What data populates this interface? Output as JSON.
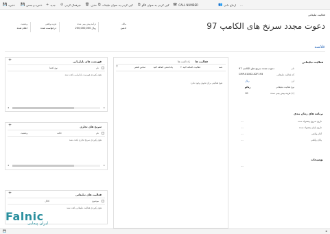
{
  "commands": [
    {
      "label": "ذخیره",
      "icon": "💾",
      "name": "save-button"
    },
    {
      "label": "ذخیره و بستن",
      "icon": "💾",
      "name": "save-close-button"
    },
    {
      "label": "جدید",
      "icon": "+",
      "name": "new-button"
    },
    {
      "label": "غیرفعال کردن",
      "icon": "⊘",
      "name": "deactivate-button"
    },
    {
      "label": "حذف",
      "icon": "🗑",
      "name": "delete-button"
    },
    {
      "label": "کپی کردن به عنوان تبلیغات",
      "icon": "⧉",
      "name": "copy-as-campaign-button"
    },
    {
      "label": "کپی کردن به عنوان الگو",
      "icon": "⧉",
      "name": "copy-as-template-button"
    },
    {
      "label": "CALL NUMBER",
      "icon": "☎",
      "name": "call-number-button"
    },
    {
      "label": "ارجاع دادن",
      "icon": "👥",
      "name": "assign-button"
    },
    {
      "label": "...",
      "icon": "",
      "name": "more-commands-button"
    }
  ],
  "header": {
    "entity": "فعالیت تبلیغاتی",
    "title": "دعوت مجدد سرنخ های الکامپ 97",
    "fields": [
      {
        "label": "مالک",
        "value": "ادمین"
      },
      {
        "label": "درآمد پیش بینی شده",
        "value": "ریال 200,000,000"
      },
      {
        "label": "هزینه واقعی",
        "value": "درخواست شده"
      },
      {
        "label": "وضعیت",
        "value": "اعلام شده"
      }
    ]
  },
  "tab_label": "خلاصه",
  "summary": {
    "title": "فعالیت تبلیغاتی",
    "rows": [
      {
        "label": "نام",
        "value": "دعوت مجدد سرنخ های الکامپ 97"
      },
      {
        "label": "کد فعالیت تبلیغاتی",
        "value": "CMP-01002-X2F193"
      },
      {
        "label": "ارز",
        "value": "ریال"
      },
      {
        "label": "نوع فعالیت تبلیغاتی",
        "value": "ریالو"
      },
      {
        "label": "هزینه پیش بینی شده (٪)",
        "value": "10"
      }
    ]
  },
  "schedule": {
    "title": "برنامه های زمان بندی",
    "rows": [
      {
        "label": "تاریخ شروع پیشنهاد شده",
        "value": "---"
      },
      {
        "label": "تاریخ پایان پیشنهاد شده",
        "value": "---"
      },
      {
        "label": "آغاز واقعی",
        "value": "---"
      },
      {
        "label": "پایان واقعی",
        "value": "---"
      }
    ]
  },
  "notes_title": "توضیحات",
  "activities": {
    "tabs": [
      "فعالیت ها",
      "یادداشت ها"
    ],
    "filter_label": "همه",
    "actions": [
      "+ فعالیت اضافه کنید",
      "یادداشتی اضافه کنید",
      "تماس تلفنی"
    ],
    "empty": "هیچ فعالیتی برای تحویل وجود ندارد"
  },
  "marketing_lists": {
    "title": "فهرست های بازاریابی",
    "columns": [
      "نام",
      "نوع اعضا"
    ],
    "empty": "هیچ رکوردی فهرست بازاریابی یافت نشد"
  },
  "competitors": {
    "title": "سرنخ های تجاری",
    "columns": [
      "نام",
      "حالت",
      "وضعیت"
    ],
    "empty": "هیچ رکوردی سرنخ تجاری یافت نشد"
  },
  "campaign_activities": {
    "title": "فعالیت های تبلیغاتی",
    "columns": [
      "موضوع",
      "کانال"
    ],
    "empty": "هیچ رکوردی فعالیت تبلیغاتی یافت نشد"
  },
  "logo": {
    "main": "Falnic",
    "sub": "ایران پیمایی"
  }
}
